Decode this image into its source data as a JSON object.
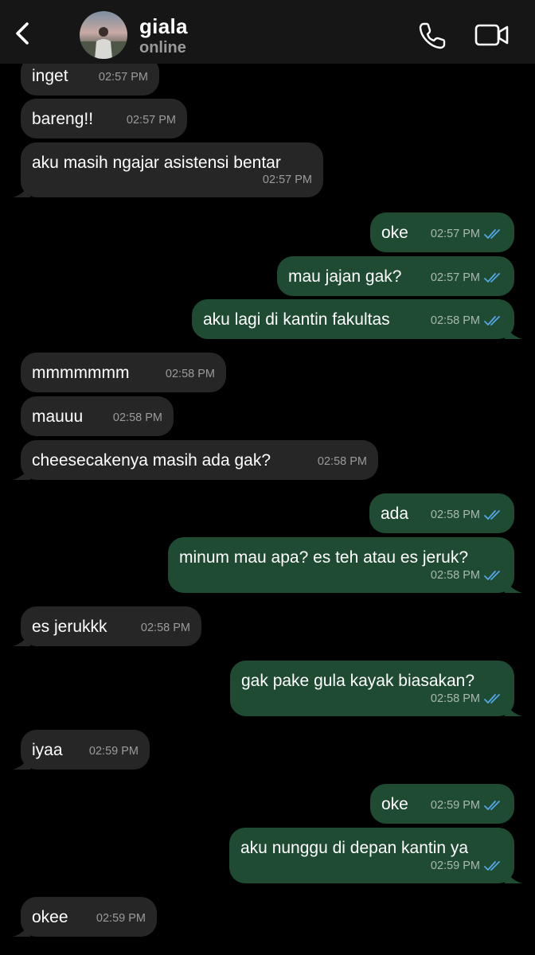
{
  "header": {
    "contact_name": "giala",
    "status": "online",
    "back_icon": "chevron-left-icon",
    "call_icon": "phone-icon",
    "video_icon": "video-camera-icon"
  },
  "colors": {
    "background": "#000000",
    "header": "#161616",
    "incoming_bubble": "#262626",
    "outgoing_bubble": "#1f4b33",
    "read_ticks": "#53a6e6"
  },
  "messages": [
    {
      "dir": "in",
      "text": "inget",
      "time": "02:57 PM"
    },
    {
      "dir": "in",
      "text": "bareng!!",
      "time": "02:57 PM"
    },
    {
      "dir": "in",
      "text": "aku masih ngajar asistensi bentar",
      "time": "02:57 PM"
    },
    {
      "dir": "out",
      "text": "oke",
      "time": "02:57 PM"
    },
    {
      "dir": "out",
      "text": "mau jajan gak?",
      "time": "02:57 PM"
    },
    {
      "dir": "out",
      "text": "aku lagi di kantin fakultas",
      "time": "02:58 PM"
    },
    {
      "dir": "in",
      "text": "mmmmmmm",
      "time": "02:58 PM"
    },
    {
      "dir": "in",
      "text": "mauuu",
      "time": "02:58 PM"
    },
    {
      "dir": "in",
      "text": "cheesecakenya masih ada gak?",
      "time": "02:58 PM"
    },
    {
      "dir": "out",
      "text": "ada",
      "time": "02:58 PM"
    },
    {
      "dir": "out",
      "text": "minum mau apa? es teh atau es jeruk?",
      "time": "02:58 PM"
    },
    {
      "dir": "in",
      "text": "es jerukkk",
      "time": "02:58 PM"
    },
    {
      "dir": "out",
      "text": "gak pake gula kayak biasakan?",
      "time": "02:58 PM"
    },
    {
      "dir": "in",
      "text": "iyaa",
      "time": "02:59 PM"
    },
    {
      "dir": "out",
      "text": "oke",
      "time": "02:59 PM"
    },
    {
      "dir": "out",
      "text": "aku nunggu di depan kantin ya",
      "time": "02:59 PM"
    },
    {
      "dir": "in",
      "text": "okee",
      "time": "02:59 PM"
    }
  ]
}
